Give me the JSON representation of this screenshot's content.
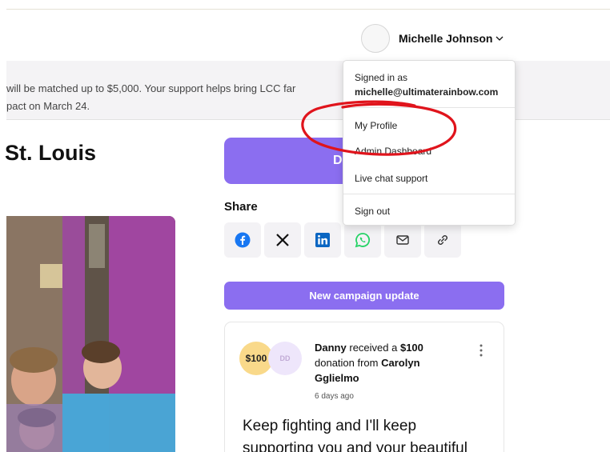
{
  "header": {
    "user_name": "Michelle Johnson"
  },
  "banner": {
    "line1": "will be matched up to $5,000. Your support helps bring LCC far",
    "line2": "pact on March 24."
  },
  "page": {
    "title": "St. Louis"
  },
  "donate": {
    "label": "D"
  },
  "share": {
    "label": "Share",
    "icons": [
      "facebook-icon",
      "x-icon",
      "linkedin-icon",
      "whatsapp-icon",
      "email-icon",
      "link-icon"
    ]
  },
  "update_button": {
    "label": "New campaign update"
  },
  "activity": {
    "amount_badge": "$100",
    "initials": "DD",
    "donor_name": "Danny",
    "text_received": "received a",
    "amount": "$100",
    "text_donation_from": "donation from",
    "from_name": "Carolyn Gglielmo",
    "time": "6 days ago",
    "message_line1": "Keep fighting and I'll keep",
    "message_line2": "supporting you and your beautiful"
  },
  "dropdown": {
    "signed_in_label": "Signed in as",
    "email": "michelle@ultimaterainbow.com",
    "items": [
      "My Profile",
      "Admin Dashboard",
      "Live chat support",
      "Sign out"
    ]
  },
  "colors": {
    "accent": "#8b6ef0",
    "annotation": "#e0141c"
  }
}
